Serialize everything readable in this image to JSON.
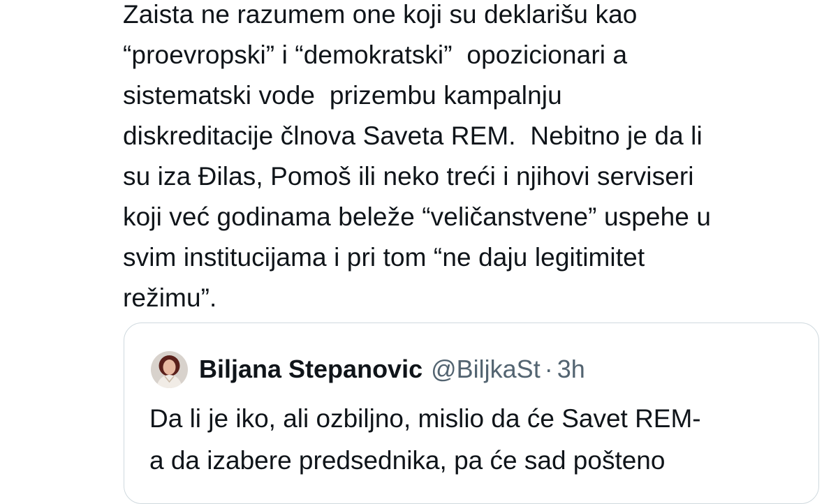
{
  "tweet": {
    "lines": [
      "Zaista ne razumem one koji su deklarišu kao",
      "“proevropski” i “demokratski”  opozicionari a",
      "sistematski vode  prizembu kampalnju",
      "diskreditacije člnova Saveta REM.  Nebitno je da li",
      "su iza Đilas, Pomoš ili neko treći i njihovi serviseri",
      "koji već godinama beleže “veličanstvene” uspehe u",
      "svim institucijama i pri tom “ne daju legitimitet",
      "režimu”."
    ]
  },
  "quoted_tweet": {
    "author_name": "Biljana Stepanovic",
    "handle": "@BiljkaSt",
    "separator": "·",
    "time": "3h",
    "avatar_icon": "profile-photo",
    "lines": [
      "Da li je iko, ali ozbiljno, mislio da će Savet REM-",
      "a da izabere predsednika, pa će sad pošteno"
    ]
  },
  "colors": {
    "text": "#0f1419",
    "secondary_text": "#536471",
    "border": "#cfd9de"
  }
}
